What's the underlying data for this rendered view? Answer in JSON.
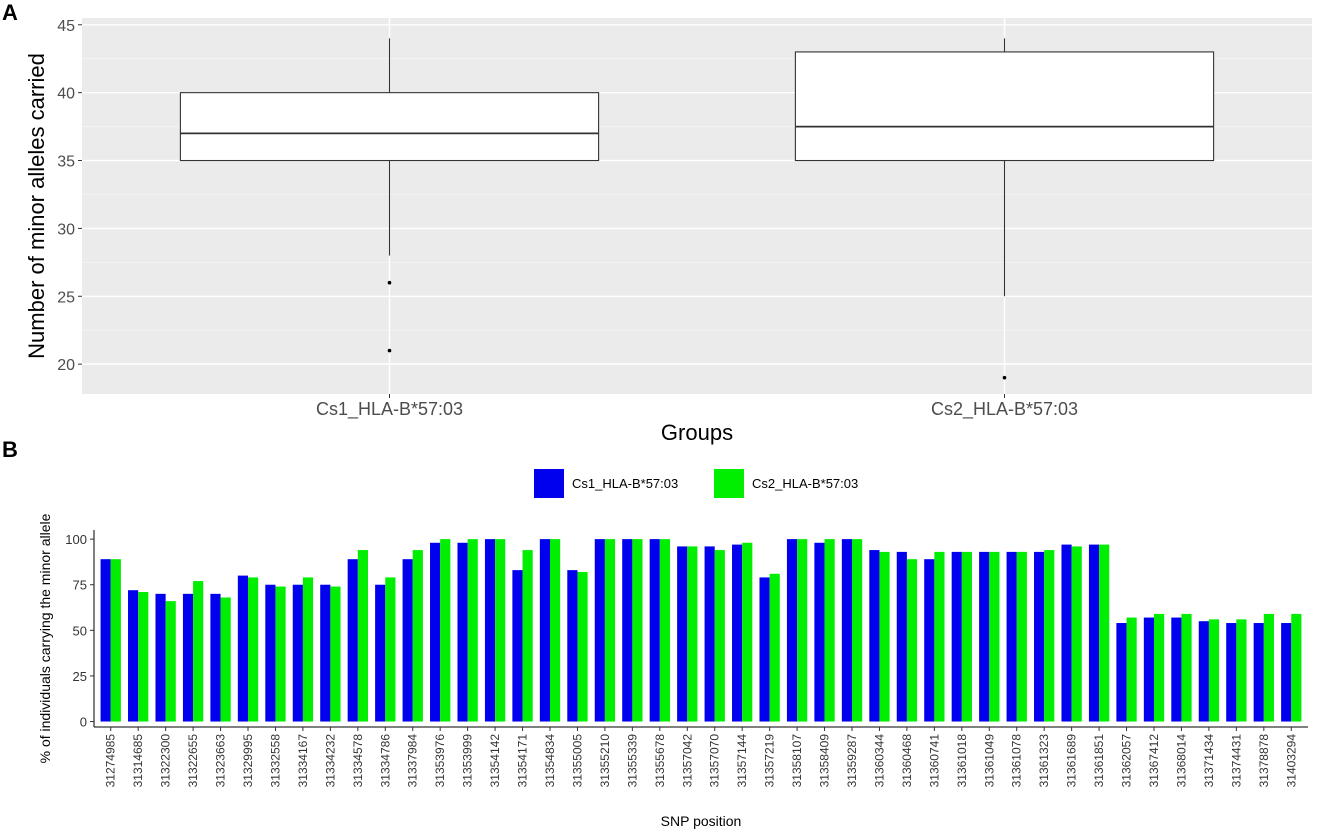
{
  "panels": {
    "a_letter": "A",
    "b_letter": "B"
  },
  "chart_data": [
    {
      "type": "box",
      "panel": "A",
      "xlabel": "Groups",
      "ylabel": "Number of minor alleles carried",
      "ylim": [
        17.8,
        45.5
      ],
      "yticks": [
        20,
        25,
        30,
        35,
        40,
        45
      ],
      "grid": true,
      "background_color": "#ebebeb",
      "categories": [
        "Cs1_HLA-B*57:03",
        "Cs2_HLA-B*57:03"
      ],
      "boxes": [
        {
          "q1": 35,
          "median": 37,
          "q3": 40,
          "whisker_low": 28,
          "whisker_high": 44,
          "outliers": [
            26,
            21
          ]
        },
        {
          "q1": 35,
          "median": 37.5,
          "q3": 43,
          "whisker_low": 25,
          "whisker_high": 44,
          "outliers": [
            19
          ]
        }
      ]
    },
    {
      "type": "bar",
      "panel": "B",
      "xlabel": "SNP position",
      "ylabel": "% of individuals carrying the minor allele",
      "ylim": [
        -3,
        105
      ],
      "yticks": [
        0,
        25,
        50,
        75,
        100
      ],
      "grid": false,
      "legend_position": "top-center",
      "categories": [
        "31274985",
        "31314685",
        "31322300",
        "31322655",
        "31323663",
        "31329995",
        "31332558",
        "31334167",
        "31334232",
        "31334578",
        "31334786",
        "31337984",
        "31353976",
        "31353999",
        "31354142",
        "31354171",
        "31354834",
        "31355005",
        "31355210",
        "31355339",
        "31355678",
        "31357042",
        "31357070",
        "31357144",
        "31357219",
        "31358107",
        "31358409",
        "31359287",
        "31360344",
        "31360468",
        "31360741",
        "31361018",
        "31361049",
        "31361078",
        "31361323",
        "31361689",
        "31361851",
        "31362057",
        "31367412",
        "31368014",
        "31371434",
        "31374431",
        "31378878",
        "31403294"
      ],
      "series": [
        {
          "name": "Cs1_HLA-B*57:03",
          "color": "#0000ee",
          "values": [
            89,
            72,
            70,
            70,
            70,
            80,
            75,
            75,
            75,
            89,
            75,
            89,
            98,
            98,
            100,
            83,
            100,
            83,
            100,
            100,
            100,
            96,
            96,
            97,
            79,
            100,
            98,
            100,
            94,
            93,
            89,
            93,
            93,
            93,
            93,
            97,
            97,
            54,
            57,
            57,
            55,
            54,
            54,
            54
          ]
        },
        {
          "name": "Cs2_HLA-B*57:03",
          "color": "#00ee00",
          "values": [
            89,
            71,
            66,
            77,
            68,
            79,
            74,
            79,
            74,
            94,
            79,
            94,
            100,
            100,
            100,
            94,
            100,
            82,
            100,
            100,
            100,
            96,
            94,
            98,
            81,
            100,
            100,
            100,
            93,
            89,
            93,
            93,
            93,
            93,
            94,
            96,
            97,
            57,
            59,
            59,
            56,
            56,
            59,
            59
          ]
        }
      ]
    }
  ]
}
